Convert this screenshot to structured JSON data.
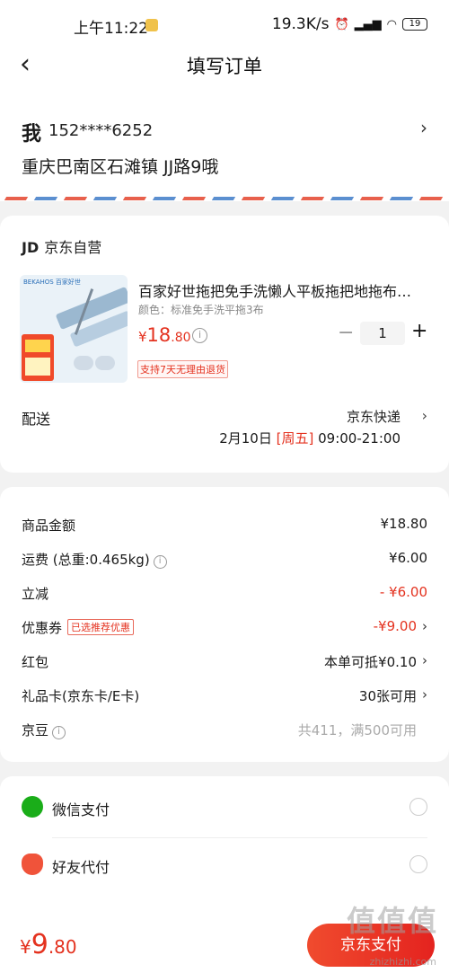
{
  "status_bar": {
    "time": "上午11:22",
    "speed": "19.3K/s",
    "battery": "19"
  },
  "nav": {
    "title": "填写订单"
  },
  "address": {
    "name": "我",
    "phone": "152****6252",
    "line": "重庆巴南区石滩镇 JJ路9哦"
  },
  "shop": {
    "logo": "JD",
    "name": "京东自营"
  },
  "product": {
    "brand_small": "BEKAHOS 百家好世",
    "title": "百家好世拖把免手洗懒人平板拖把地拖布…",
    "spec": "颜色：标准免手洗平拖3布",
    "price_symbol": "¥",
    "price_int": "18",
    "price_dec": ".80",
    "quantity": "1",
    "return_tag": "支持7天无理由退货"
  },
  "shipping": {
    "label": "配送",
    "method": "京东快递",
    "date": "2月10日",
    "weekday": "[周五]",
    "time": "09:00-21:00"
  },
  "summary": {
    "goods_label": "商品金额",
    "goods_value": "¥18.80",
    "freight_label": "运费 (总重:0.465kg)",
    "freight_value": "¥6.00",
    "discount_label": "立减",
    "discount_value": "- ¥6.00",
    "coupon_label": "优惠券",
    "coupon_tag": "已选推荐优惠",
    "coupon_value": "-¥9.00",
    "redpack_label": "红包",
    "redpack_value": "本单可抵¥0.10",
    "giftcard_label": "礼品卡(京东卡/E卡)",
    "giftcard_value": "30张可用",
    "jingdou_label": "京豆",
    "jingdou_value": "共411，满500可用"
  },
  "payment": {
    "wechat_label": "微信支付",
    "friend_label": "好友代付"
  },
  "bottom_bar": {
    "symbol": "¥",
    "total_int": "9",
    "total_dec": ".80",
    "pay_button": "京东支付"
  },
  "watermark": {
    "main": "值值值",
    "site": "zhizhizhi.com"
  },
  "colors": {
    "accent": "#e4321f",
    "wechat": "#1aad19",
    "stripe_red": "#e8604c",
    "stripe_blue": "#5b8fd0"
  }
}
